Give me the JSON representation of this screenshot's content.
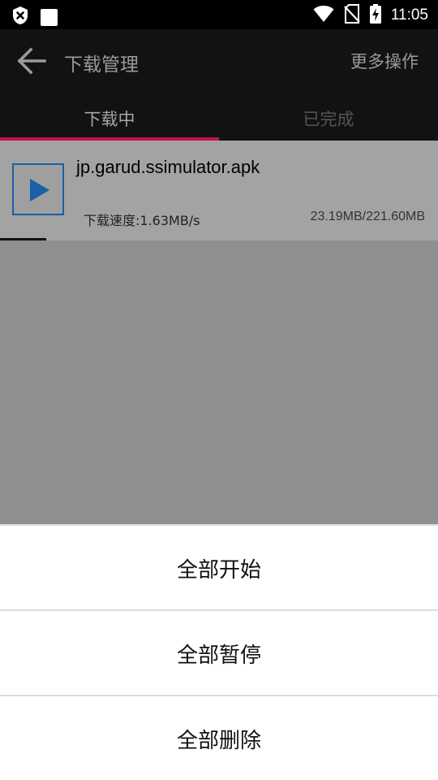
{
  "status_bar": {
    "time": "11:05",
    "icons": [
      "shield-close-icon",
      "notification-square-icon",
      "wifi-icon",
      "no-sim-icon",
      "battery-charging-icon"
    ]
  },
  "app_bar": {
    "title": "下载管理",
    "more_label": "更多操作"
  },
  "tabs": [
    {
      "label": "下载中",
      "active": true
    },
    {
      "label": "已完成",
      "active": false
    }
  ],
  "download": {
    "file_name": "jp.garud.ssimulator.apk",
    "speed": "下载速度:1.63MB/s",
    "size": "23.19MB/221.60MB",
    "progress": 0.105
  },
  "sheet": {
    "start_all": "全部开始",
    "pause_all": "全部暂停",
    "delete_all": "全部删除"
  },
  "colors": {
    "accent": "#c21449",
    "play_blue": "#1a5fa8",
    "overlay_gray": "#8f8f8f"
  }
}
